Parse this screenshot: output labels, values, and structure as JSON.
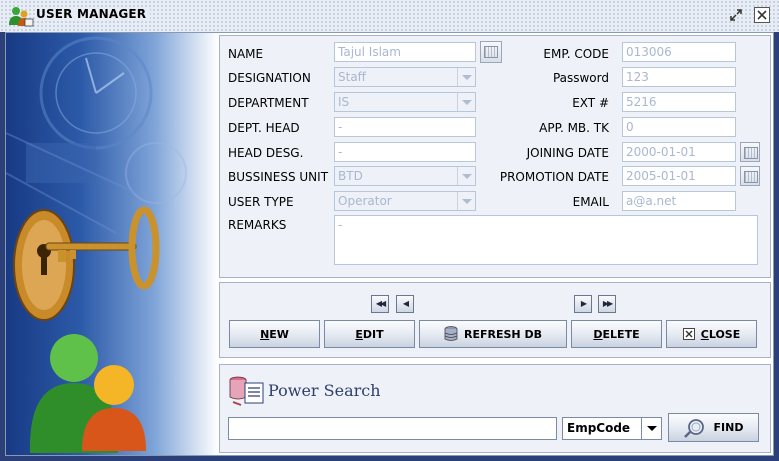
{
  "window": {
    "title": "USER MANAGER"
  },
  "form": {
    "name_label": "NAME",
    "name_value": "Tajul Islam",
    "designation_label": "DESIGNATION",
    "designation_value": "Staff",
    "department_label": "DEPARTMENT",
    "department_value": "IS",
    "dept_head_label": "DEPT. HEAD",
    "dept_head_value": "-",
    "head_desg_label": "HEAD DESG.",
    "head_desg_value": "-",
    "business_unit_label": "BUSSINESS UNIT",
    "business_unit_value": "BTD",
    "user_type_label": "USER TYPE",
    "user_type_value": "Operator",
    "remarks_label": "REMARKS",
    "remarks_value": "-",
    "emp_code_label": "EMP. CODE",
    "emp_code_value": "013006",
    "password_label": "Password",
    "password_value": "123",
    "ext_label": "EXT #",
    "ext_value": "5216",
    "app_mb_tk_label": "APP. MB. TK",
    "app_mb_tk_value": "0",
    "joining_date_label": "JOINING DATE",
    "joining_date_value": "2000-01-01",
    "promotion_date_label": "PROMOTION DATE",
    "promotion_date_value": "2005-01-01",
    "email_label": "EMAIL",
    "email_value": "a@a.net"
  },
  "navigation": {
    "first": "◀◀",
    "prev": "◀",
    "next": "▶",
    "last": "▶▶"
  },
  "actions": {
    "new_key": "N",
    "new_rest": "EW",
    "edit_key": "E",
    "edit_rest": "DIT",
    "refresh_label": "REFRESH DB",
    "delete_key": "D",
    "delete_rest": "ELETE",
    "close_key": "C",
    "close_rest": "LOSE"
  },
  "power_search": {
    "title": "Power Search",
    "query": "",
    "field_selected": "EmpCode",
    "find_label": "FIND"
  },
  "colors": {
    "accent": "#2b3f78",
    "panel_bg": "#eef1f7",
    "disabled_text": "#a8b8d0"
  }
}
